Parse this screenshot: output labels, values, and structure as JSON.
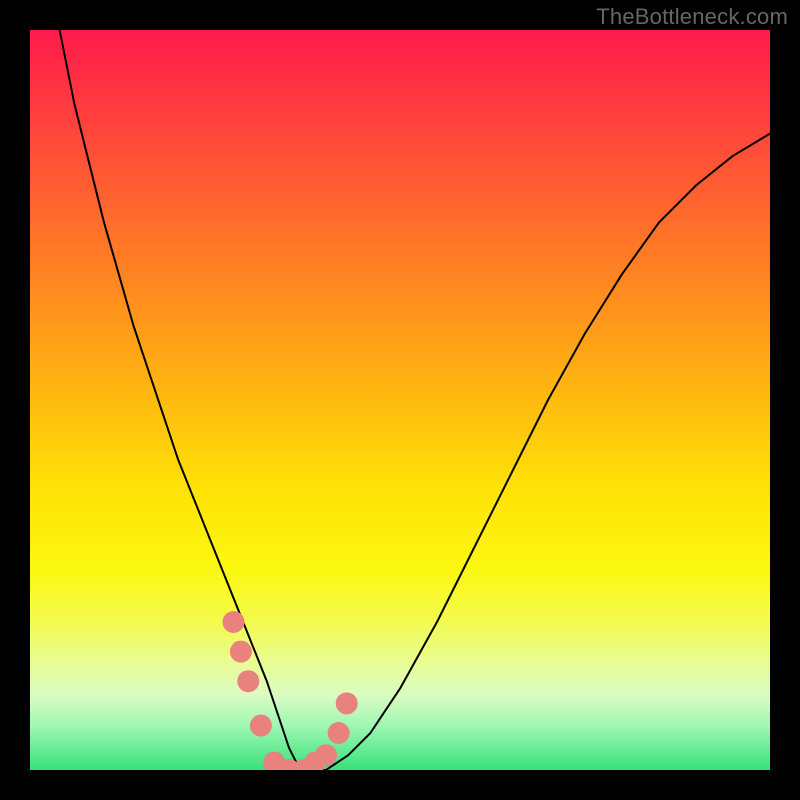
{
  "watermark": "TheBottleneck.com",
  "chart_data": {
    "type": "line",
    "title": "",
    "xlabel": "",
    "ylabel": "",
    "xlim": [
      0,
      100
    ],
    "ylim": [
      0,
      100
    ],
    "grid": false,
    "legend": false,
    "series": [
      {
        "name": "bottleneck-curve",
        "color": "#000000",
        "x": [
          4,
          6,
          8,
          10,
          12,
          14,
          16,
          18,
          20,
          22,
          24,
          26,
          28,
          30,
          32,
          33,
          34,
          35,
          36,
          38,
          40,
          43,
          46,
          50,
          55,
          60,
          65,
          70,
          75,
          80,
          85,
          90,
          95,
          100
        ],
        "y": [
          100,
          90,
          82,
          74,
          67,
          60,
          54,
          48,
          42,
          37,
          32,
          27,
          22,
          17,
          12,
          9,
          6,
          3,
          1,
          0,
          0,
          2,
          5,
          11,
          20,
          30,
          40,
          50,
          59,
          67,
          74,
          79,
          83,
          86
        ]
      },
      {
        "name": "highlight-dots",
        "color": "#e9817f",
        "type": "scatter",
        "x": [
          27.5,
          28.5,
          29.5,
          31.2,
          33.0,
          35.0,
          37.0,
          38.5,
          40.0,
          41.7,
          42.8
        ],
        "y": [
          20,
          16,
          12,
          6,
          1,
          0,
          0,
          1,
          2,
          5,
          9
        ]
      }
    ],
    "background_gradient": {
      "top": "#ff1a4b",
      "mid": "#ffe205",
      "bottom": "#38e27a"
    }
  }
}
